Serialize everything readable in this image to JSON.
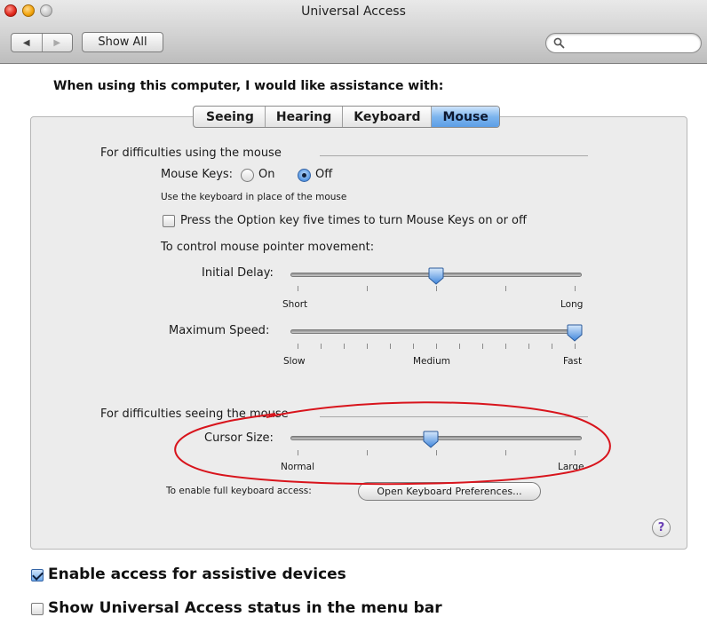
{
  "window": {
    "title": "Universal Access"
  },
  "toolbar": {
    "back_icon": "back-arrow-icon",
    "forward_icon": "forward-arrow-icon",
    "show_all_label": "Show All",
    "search_placeholder": ""
  },
  "prompt": "When using this computer, I would like assistance with:",
  "tabs": [
    {
      "label": "Seeing",
      "selected": false
    },
    {
      "label": "Hearing",
      "selected": false
    },
    {
      "label": "Keyboard",
      "selected": false
    },
    {
      "label": "Mouse",
      "selected": true
    }
  ],
  "mouse_section": {
    "title": "For difficulties using the mouse",
    "mouse_keys_label": "Mouse Keys:",
    "on_label": "On",
    "off_label": "Off",
    "mouse_keys_value": "Off",
    "mouse_keys_hint": "Use the keyboard in place of the mouse",
    "option_key_label": "Press the Option key five times to turn Mouse Keys on or off",
    "option_key_checked": false,
    "movement_label": "To control mouse pointer movement:",
    "initial_delay": {
      "label": "Initial Delay:",
      "min_label": "Short",
      "max_label": "Long",
      "value_fraction": 0.5
    },
    "maximum_speed": {
      "label": "Maximum Speed:",
      "min_label": "Slow",
      "mid_label": "Medium",
      "max_label": "Fast",
      "value_fraction": 1.0
    }
  },
  "seeing_section": {
    "title": "For difficulties seeing the mouse",
    "cursor_size": {
      "label": "Cursor Size:",
      "min_label": "Normal",
      "max_label": "Large",
      "value_fraction": 0.48
    }
  },
  "keyboard_access": {
    "label": "To enable full keyboard access:",
    "button_label": "Open Keyboard Preferences..."
  },
  "help_label": "?",
  "footer": {
    "assistive_label": "Enable access for assistive devices",
    "assistive_checked": true,
    "status_label": "Show Universal Access status in the menu bar",
    "status_checked": false
  },
  "colors": {
    "selection_blue": "#5c9ee6",
    "annotation_red": "#d8141c",
    "panel_bg": "#ececec"
  }
}
